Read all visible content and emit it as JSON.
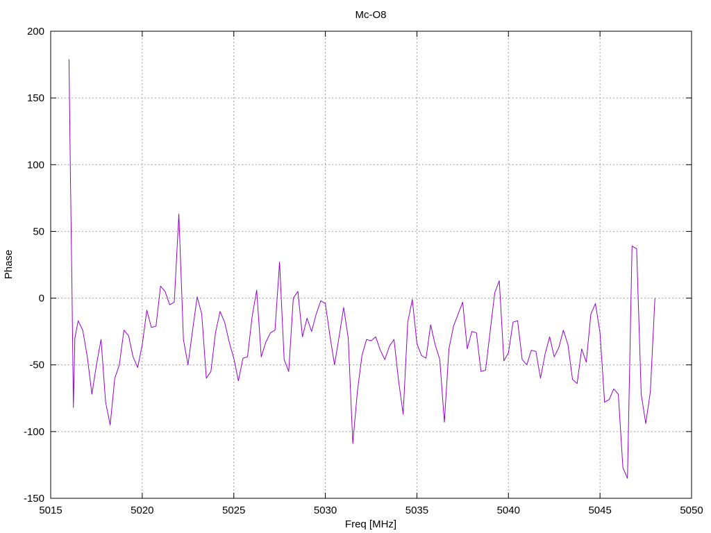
{
  "chart_data": {
    "type": "line",
    "title": "Mc-O8",
    "xlabel": "Freq [MHz]",
    "ylabel": "Phase",
    "xlim": [
      5015,
      5050
    ],
    "ylim": [
      -150,
      200
    ],
    "xticks": [
      "5015",
      "5020",
      "5025",
      "5030",
      "5035",
      "5040",
      "5045",
      "5050"
    ],
    "yticks": [
      "-150",
      "-100",
      "-50",
      "0",
      "50",
      "100",
      "150",
      "200"
    ],
    "grid": true,
    "legend": "none",
    "series": [
      {
        "color": "#9400d3",
        "x": [
          5016.0,
          5016.08,
          5016.16,
          5016.24,
          5016.32,
          5016.5,
          5016.75,
          5017.0,
          5017.25,
          5017.5,
          5017.75,
          5018.0,
          5018.25,
          5018.5,
          5018.75,
          5019.0,
          5019.25,
          5019.5,
          5019.75,
          5020.0,
          5020.25,
          5020.5,
          5020.75,
          5021.0,
          5021.25,
          5021.5,
          5021.75,
          5022.0,
          5022.25,
          5022.5,
          5022.75,
          5023.0,
          5023.25,
          5023.5,
          5023.75,
          5024.0,
          5024.25,
          5024.5,
          5024.75,
          5025.0,
          5025.25,
          5025.5,
          5025.75,
          5026.0,
          5026.25,
          5026.5,
          5026.75,
          5027.0,
          5027.25,
          5027.5,
          5027.75,
          5028.0,
          5028.25,
          5028.5,
          5028.75,
          5029.0,
          5029.25,
          5029.5,
          5029.75,
          5030.0,
          5030.25,
          5030.5,
          5030.75,
          5031.0,
          5031.25,
          5031.5,
          5031.75,
          5032.0,
          5032.25,
          5032.5,
          5032.75,
          5033.0,
          5033.25,
          5033.5,
          5033.75,
          5034.0,
          5034.25,
          5034.5,
          5034.75,
          5035.0,
          5035.25,
          5035.5,
          5035.75,
          5036.0,
          5036.25,
          5036.5,
          5036.75,
          5037.0,
          5037.25,
          5037.5,
          5037.75,
          5038.0,
          5038.25,
          5038.5,
          5038.75,
          5039.0,
          5039.25,
          5039.5,
          5039.75,
          5040.0,
          5040.25,
          5040.5,
          5040.75,
          5041.0,
          5041.25,
          5041.5,
          5041.75,
          5042.0,
          5042.25,
          5042.5,
          5042.75,
          5043.0,
          5043.25,
          5043.5,
          5043.75,
          5044.0,
          5044.25,
          5044.5,
          5044.75,
          5045.0,
          5045.25,
          5045.5,
          5045.75,
          5046.0,
          5046.25,
          5046.5,
          5046.75,
          5047.0,
          5047.25,
          5047.5,
          5047.75,
          5048.0
        ],
        "y": [
          179,
          90,
          10,
          -82,
          -30,
          -17,
          -24,
          -44,
          -72,
          -50,
          -31,
          -78,
          -95,
          -60,
          -50,
          -24,
          -28,
          -44,
          -52,
          -35,
          -9,
          -22,
          -21,
          9,
          5,
          -5,
          -3,
          63,
          -31,
          -50,
          -24,
          1,
          -12,
          -60,
          -55,
          -26,
          -10,
          -18,
          -33,
          -45,
          -62,
          -45,
          -44,
          -14,
          6,
          -44,
          -33,
          -26,
          -24,
          27,
          -46,
          -55,
          0,
          5,
          -29,
          -15,
          -25,
          -12,
          -2,
          -4,
          -28,
          -50,
          -29,
          -7,
          -30,
          -109,
          -70,
          -43,
          -31,
          -32,
          -29,
          -39,
          -46,
          -36,
          -31,
          -62,
          -87,
          -18,
          -1,
          -34,
          -43,
          -45,
          -20,
          -35,
          -46,
          -93,
          -38,
          -21,
          -12,
          -3,
          -38,
          -25,
          -26,
          -55,
          -54,
          -25,
          4,
          13,
          -47,
          -41,
          -18,
          -17,
          -46,
          -50,
          -39,
          -40,
          -60,
          -42,
          -29,
          -44,
          -37,
          -24,
          -35,
          -61,
          -64,
          -38,
          -48,
          -12,
          -4,
          -26,
          -78,
          -76,
          -68,
          -72,
          -127,
          -135,
          39,
          37,
          -72,
          -94,
          -70,
          0
        ]
      }
    ]
  }
}
